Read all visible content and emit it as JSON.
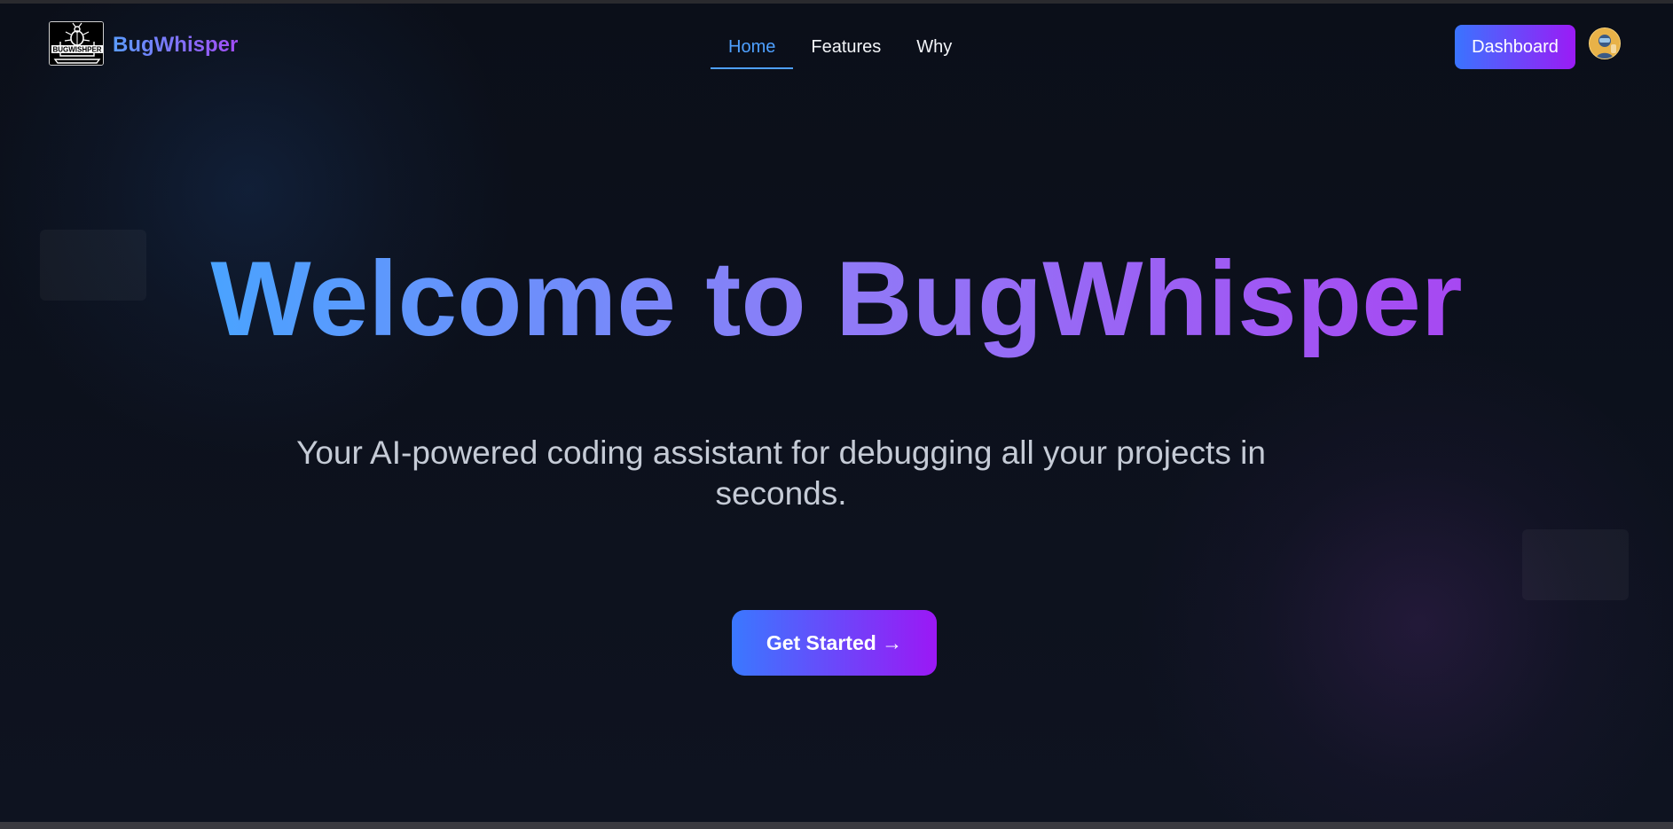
{
  "nav": {
    "logo_text": "BUGWISHPER",
    "brand": "BugWhisper",
    "links": [
      {
        "label": "Home",
        "active": true
      },
      {
        "label": "Features",
        "active": false
      },
      {
        "label": "Why",
        "active": false
      }
    ],
    "dashboard_label": "Dashboard"
  },
  "hero": {
    "title": "Welcome to BugWhisper",
    "subtitle": "Your AI-powered coding assistant for debugging all your projects in seconds.",
    "cta_label": "Get Started →"
  },
  "colors": {
    "background": "#0c111b",
    "accent_blue": "#4ea0ff",
    "accent_purple": "#9b18f5",
    "text_muted": "#c5cbd6"
  },
  "icons": {
    "logo": "bug-laptop-logo",
    "avatar": "user-avatar"
  }
}
